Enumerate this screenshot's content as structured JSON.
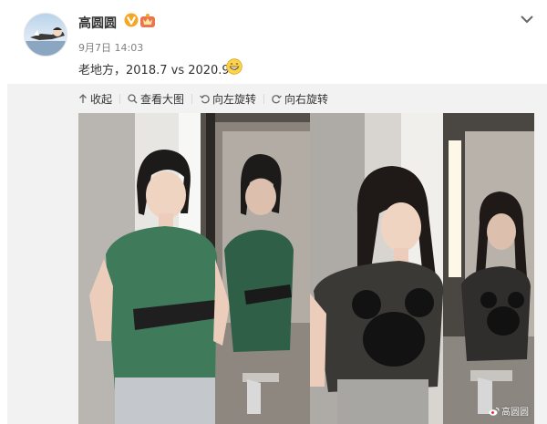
{
  "post": {
    "user_name": "高圆圆",
    "time": "9月7日 14:03",
    "text": "老地方，2018.7 vs 2020.9"
  },
  "icons": {
    "avatar": "cartoon-avatar",
    "vip": "verified-v-badge",
    "level": "member-crown-badge",
    "emoji": "grinning-face-emoji",
    "more": "chevron-down-icon"
  },
  "toolbar": {
    "collapse_label": "收起",
    "view_large_label": "查看大图",
    "rotate_left_label": "向左旋转",
    "rotate_right_label": "向右旋转"
  },
  "watermark": {
    "text": "高圆圆"
  },
  "colors": {
    "accent": "#eb7350",
    "badge_gold": "#f5a623",
    "text": "#333333",
    "meta": "#808080"
  }
}
